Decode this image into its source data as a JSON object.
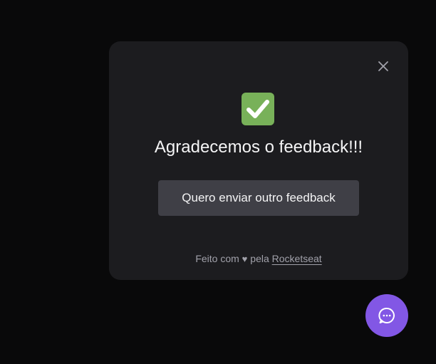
{
  "widget": {
    "close_icon": "close-icon",
    "success_icon": "check-mark-icon",
    "success_icon_color": "#78b159",
    "title": "Agradecemos o feedback!!!",
    "again_button_label": "Quero enviar outro feedback",
    "footer": {
      "prefix": "Feito com",
      "heart_glyph": "♥",
      "middle": "pela",
      "link_text": "Rocketseat"
    }
  },
  "fab": {
    "icon": "chat-bubble-icon",
    "color": "#8257e5"
  }
}
